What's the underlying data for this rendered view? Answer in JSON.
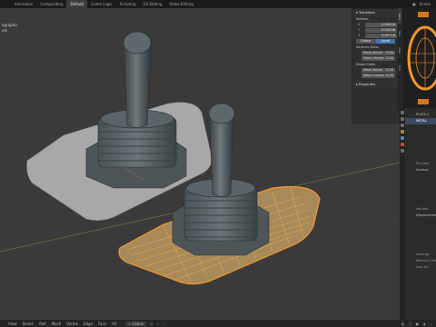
{
  "topbar": {
    "tabs": [
      "Animation",
      "Compositing",
      "Default",
      "Game Logic",
      "Scripting",
      "UV Editing",
      "Video Editing"
    ],
    "active_index": 2,
    "scene_label": "Scene"
  },
  "viewport": {
    "mode_label": "ographic",
    "collection_label": "ple"
  },
  "npanel": {
    "title": "Transform",
    "median_label": "Median:",
    "coords": [
      {
        "axis": "X",
        "value": "-0.00000"
      },
      {
        "axis": "Y",
        "value": "-0.01236"
      },
      {
        "axis": "Z",
        "value": "0.49716"
      }
    ],
    "space_buttons": [
      "Global",
      "Local"
    ],
    "vertex_weights_label": "Vertices Data:",
    "vertex_fields": [
      {
        "label": "Mean Bevel",
        "value": "0.00"
      },
      {
        "label": "Mean Vertex",
        "value": "0.00"
      }
    ],
    "edges_label": "Edges Data:",
    "edge_fields": [
      {
        "label": "Mean Bevel",
        "value": "0.00"
      },
      {
        "label": "Mean Crease",
        "value": "0.00"
      }
    ],
    "properties_label": "Properties"
  },
  "side_tabs": [
    "Item",
    "Tool",
    "View",
    "Edit"
  ],
  "properties": {
    "object_name": "PLATE.0",
    "material_name": "METAL",
    "rows": [
      "Preview",
      "Surface",
      "Volume",
      "Displacement",
      "Settings",
      "Material Line",
      "Line Art"
    ]
  },
  "bottombar": {
    "menus": [
      "View",
      "Select",
      "Add",
      "Mesh",
      "Vertex",
      "Edge",
      "Face",
      "UV"
    ],
    "transform_orientation": "Global"
  },
  "colors": {
    "viewport_bg": "#3a3a3a",
    "selection_orange": "#f5962a",
    "active_blue": "#4772b3"
  }
}
